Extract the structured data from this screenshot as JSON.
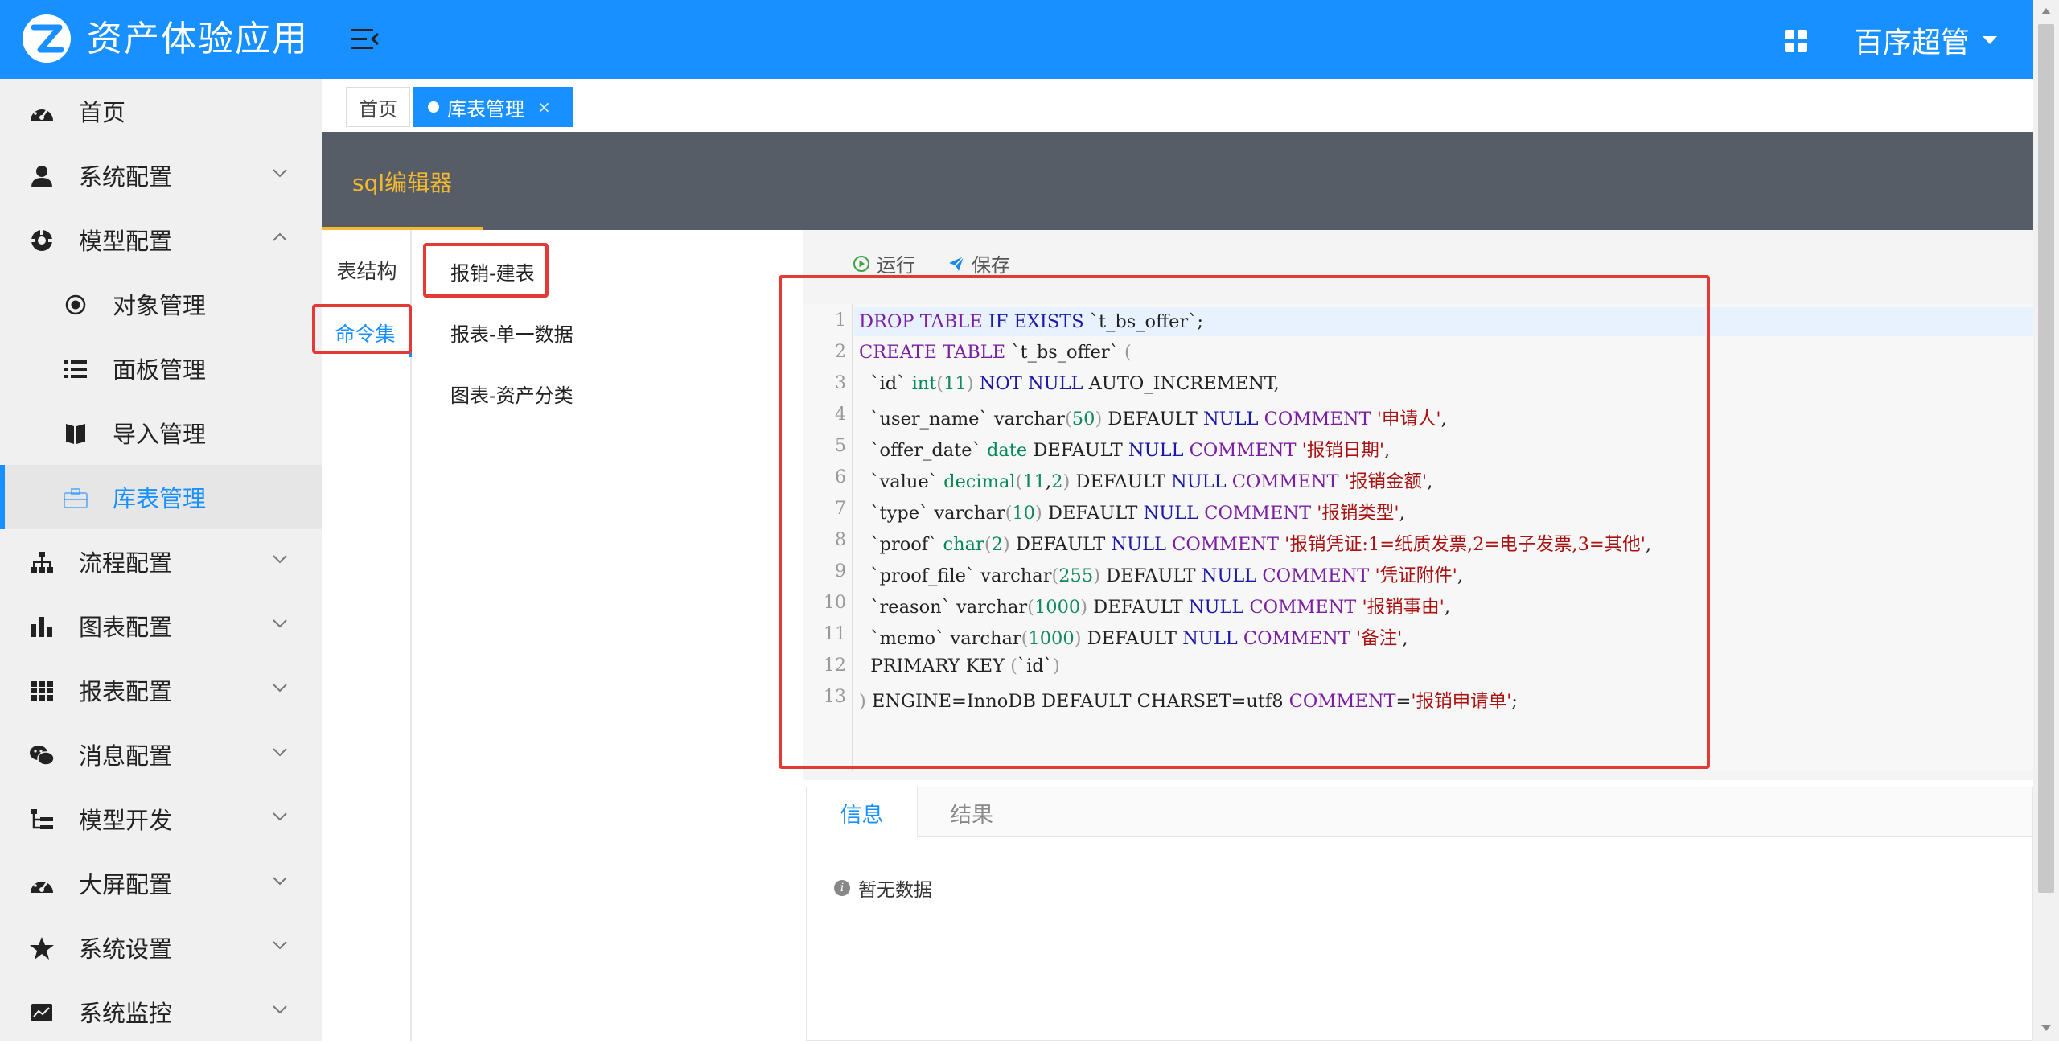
{
  "app": {
    "title": "资产体验应用",
    "user": "百序超管"
  },
  "sidebar": {
    "items": [
      {
        "label": "首页",
        "icon": "dashboard-icon"
      },
      {
        "label": "系统配置",
        "icon": "user-icon"
      },
      {
        "label": "模型配置",
        "icon": "model-icon",
        "expanded": true
      },
      {
        "label": "对象管理",
        "icon": "target-icon",
        "sub": true
      },
      {
        "label": "面板管理",
        "icon": "list-icon",
        "sub": true
      },
      {
        "label": "导入管理",
        "icon": "book-icon",
        "sub": true
      },
      {
        "label": "库表管理",
        "icon": "briefcase-icon",
        "sub": true,
        "active": true
      },
      {
        "label": "流程配置",
        "icon": "sitemap-icon"
      },
      {
        "label": "图表配置",
        "icon": "bar-chart-icon"
      },
      {
        "label": "报表配置",
        "icon": "table-icon"
      },
      {
        "label": "消息配置",
        "icon": "wechat-icon"
      },
      {
        "label": "模型开发",
        "icon": "tree-icon"
      },
      {
        "label": "大屏配置",
        "icon": "dashboard-icon"
      },
      {
        "label": "系统设置",
        "icon": "star-icon"
      },
      {
        "label": "系统监控",
        "icon": "monitor-icon"
      }
    ]
  },
  "tabs": {
    "home": "首页",
    "active": "库表管理",
    "close": "×"
  },
  "page": {
    "title": "sql编辑器"
  },
  "vtabs": {
    "structure": "表结构",
    "commands": "命令集"
  },
  "commands": [
    "报销-建表",
    "报表-单一数据",
    "图表-资产分类"
  ],
  "toolbar": {
    "run": "运行",
    "save": "保存"
  },
  "editor": {
    "line_numbers": [
      "1",
      "2",
      "3",
      "4",
      "5",
      "6",
      "7",
      "8",
      "9",
      "10",
      "11",
      "12",
      "13"
    ]
  },
  "result": {
    "tabs": [
      "信息",
      "结果"
    ],
    "empty": "暂无数据"
  },
  "colors": {
    "primary": "#1890ff",
    "header": "#1890ff",
    "accent": "#f5b92f",
    "highlight": "#e53935"
  }
}
